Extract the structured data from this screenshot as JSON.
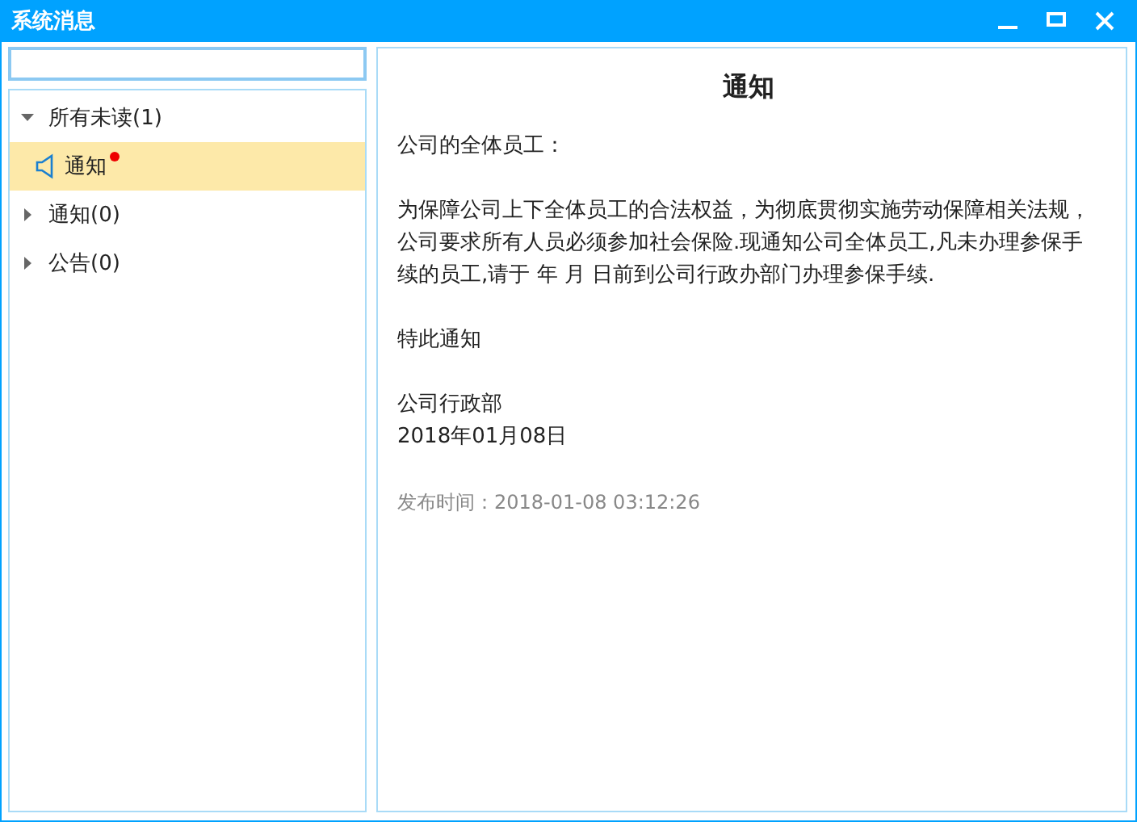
{
  "window": {
    "title": "系统消息"
  },
  "tree": [
    {
      "label": "所有未读(1)",
      "expanded": true,
      "selected": false,
      "children": [
        {
          "label": "通知",
          "kind": "message",
          "unread": true,
          "selected": true
        }
      ]
    },
    {
      "label": "通知(0)",
      "expanded": false,
      "selected": false
    },
    {
      "label": "公告(0)",
      "expanded": false,
      "selected": false
    }
  ],
  "message": {
    "title": "通知",
    "greeting": "公司的全体员工：",
    "body": "为保障公司上下全体员工的合法权益，为彻底贯彻实施劳动保障相关法规，公司要求所有人员必须参加社会保险.现通知公司全体员工,凡未办理参保手续的员工,请于 年 月 日前到公司行政办部门办理参保手续.",
    "closing": "特此通知",
    "department": "公司行政部",
    "date": "2018年01月08日",
    "published": "发布时间：2018-01-08 03:12:26"
  }
}
